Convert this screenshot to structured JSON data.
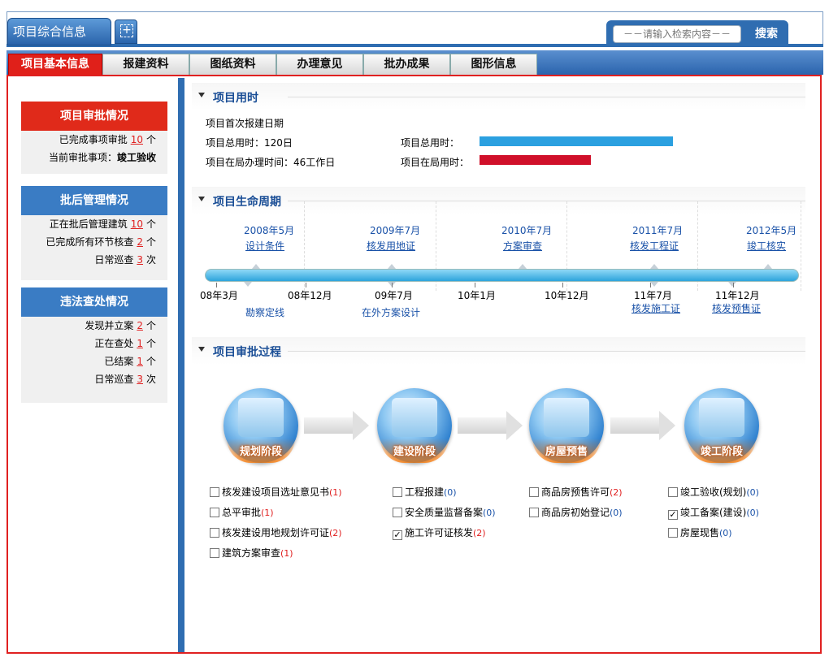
{
  "header": {
    "main_tab": "项目综合信息",
    "add_tab": "+",
    "search_placeholder": "－－请输入检索内容－－",
    "search_button": "搜索"
  },
  "nav": {
    "tabs": [
      {
        "label": "项目基本信息",
        "active": true
      },
      {
        "label": "报建资料"
      },
      {
        "label": "图纸资料"
      },
      {
        "label": "办理意见"
      },
      {
        "label": "批办成果"
      },
      {
        "label": "图形信息"
      }
    ]
  },
  "left": {
    "approval": {
      "title": "项目审批情况",
      "rows": [
        {
          "pre": "已完成事项审批",
          "num": "10",
          "suf": "个"
        }
      ],
      "current_label": "当前审批事项：",
      "current_value": "竣工验收"
    },
    "post_mgmt": {
      "title": "批后管理情况",
      "rows": [
        {
          "pre": "正在批后管理建筑",
          "num": "10",
          "suf": "个"
        },
        {
          "pre": "已完成所有环节核查",
          "num": "2",
          "suf": "个"
        },
        {
          "pre": "日常巡查",
          "num": "3",
          "suf": "次"
        }
      ]
    },
    "violation": {
      "title": "违法查处情况",
      "rows": [
        {
          "pre": "发现并立案",
          "num": "2",
          "suf": "个"
        },
        {
          "pre": "正在查处",
          "num": "1",
          "suf": "个"
        },
        {
          "pre": "已结案",
          "num": "1",
          "suf": "个"
        },
        {
          "pre": "日常巡查",
          "num": "3",
          "suf": "次"
        }
      ]
    }
  },
  "time": {
    "title": "项目用时",
    "first_date_label": "项目首次报建日期",
    "total_time": "项目总用时：120日",
    "office_time": "项目在局办理时间：46工作日",
    "total_bar_label": "项目总用时：",
    "office_bar_label": "项目在局用时：",
    "total_fraction": 1.0,
    "office_fraction": 0.575,
    "colors": {
      "total": "#2ba0e0",
      "office": "#d0102a"
    }
  },
  "lifecycle": {
    "title": "项目生命周期",
    "top": [
      {
        "date": "2008年5月",
        "label": "设计条件"
      },
      {
        "date": "2009年7月",
        "label": "核发用地证"
      },
      {
        "date": "2010年7月",
        "label": "方案审查"
      },
      {
        "date": "2011年7月",
        "label": "核发工程证"
      },
      {
        "date": "2012年5月",
        "label": "竣工核实"
      }
    ],
    "bottom": [
      "08年3月",
      "08年12月",
      "09年7月",
      "10年1月",
      "10年12月",
      "11年7月",
      "11年12月"
    ],
    "bottom_labels": [
      {
        "text": "勘察定线",
        "link": false
      },
      {
        "text": "在外方案设计",
        "link": false
      },
      {
        "text": "核发施工证",
        "link": true
      },
      {
        "text": "核发预售证",
        "link": true
      }
    ]
  },
  "process": {
    "title": "项目审批过程",
    "stages": [
      {
        "label": "规划阶段",
        "icon": "blueprint-icon"
      },
      {
        "label": "建设阶段",
        "icon": "crane-icon"
      },
      {
        "label": "房屋预售",
        "icon": "document-check-icon"
      },
      {
        "label": "竣工阶段",
        "icon": "buildings-icon"
      }
    ],
    "columns": [
      [
        {
          "text": "核发建设项目选址意见书",
          "count": "(1)",
          "checked": false
        },
        {
          "text": "总平审批",
          "count": "(1)",
          "checked": false
        },
        {
          "text": "核发建设用地规划许可证",
          "count": "(2)",
          "checked": false
        },
        {
          "text": "建筑方案审查",
          "count": "(1)",
          "checked": false
        }
      ],
      [
        {
          "text": "工程报建",
          "count": "(0)",
          "checked": false
        },
        {
          "text": "安全质量监督备案",
          "count": "(0)",
          "checked": false
        },
        {
          "text": "施工许可证核发",
          "count": "(2)",
          "checked": true
        }
      ],
      [
        {
          "text": "商品房预售许可",
          "count": "(2)",
          "checked": false
        },
        {
          "text": "商品房初始登记",
          "count": "(0)",
          "checked": false
        }
      ],
      [
        {
          "text": "竣工验收(规划)",
          "count": "(0)",
          "checked": false
        },
        {
          "text": "竣工备案(建设)",
          "count": "(0)",
          "checked": true
        },
        {
          "text": "房屋现售",
          "count": "(0)",
          "checked": false
        }
      ]
    ]
  }
}
